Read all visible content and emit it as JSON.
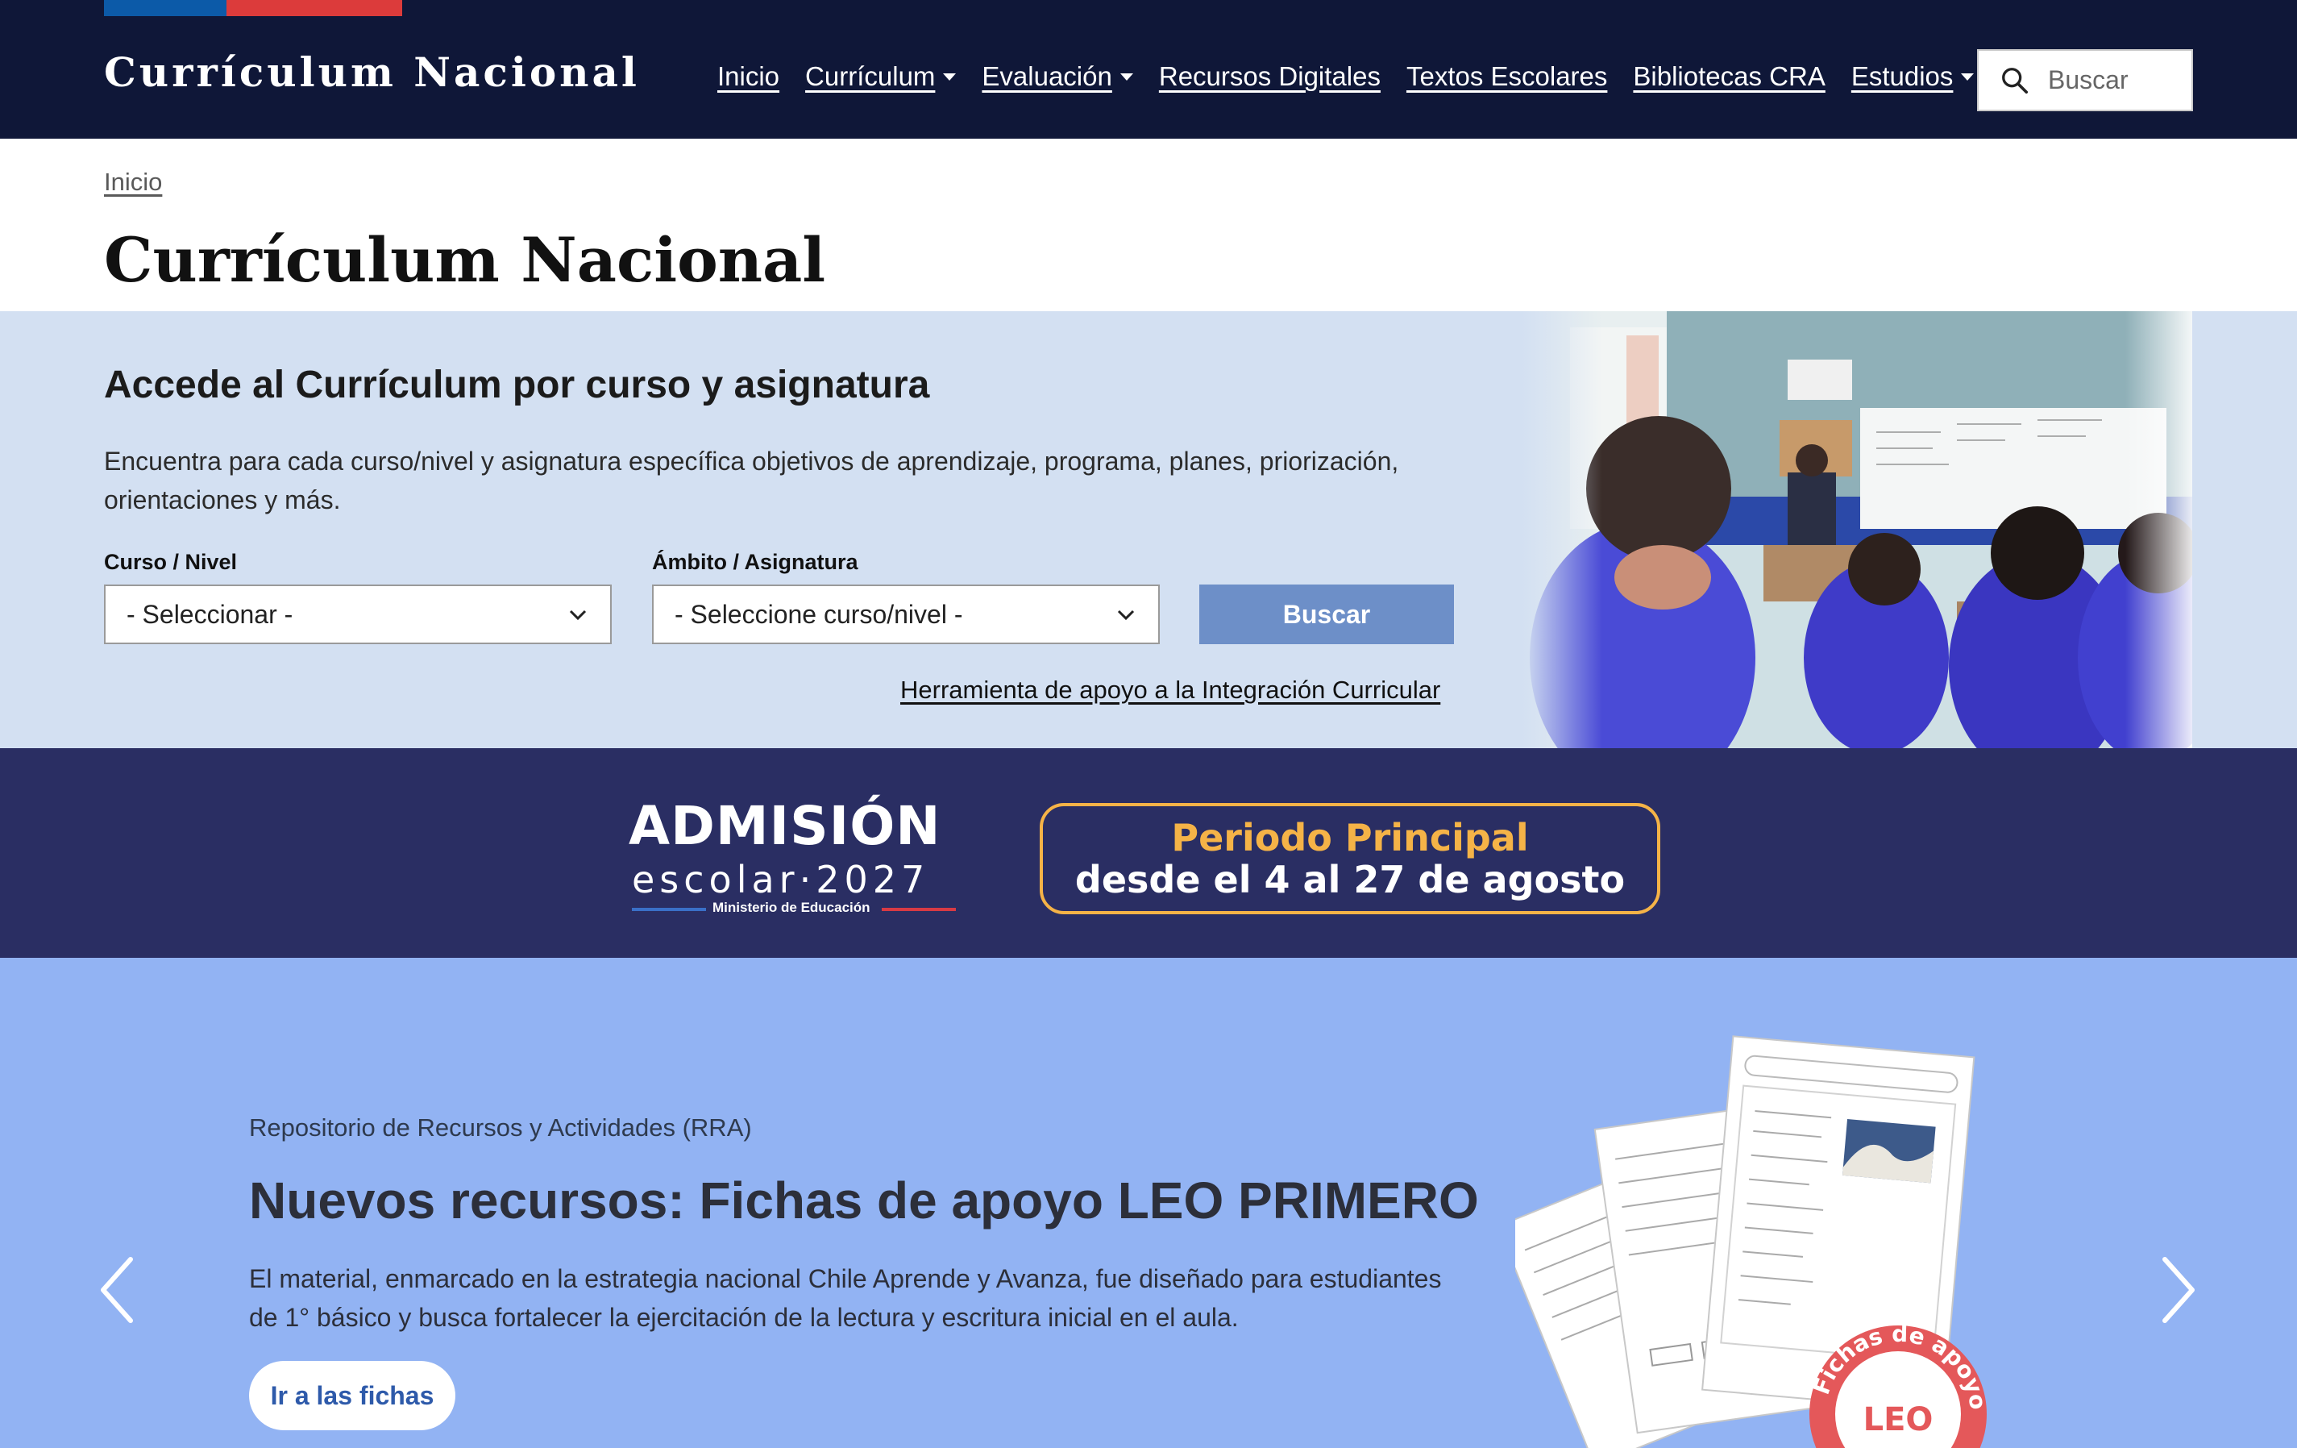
{
  "header": {
    "brand": "Currículum Nacional",
    "nav": [
      {
        "label": "Inicio",
        "dropdown": false
      },
      {
        "label": "Currículum",
        "dropdown": true
      },
      {
        "label": "Evaluación",
        "dropdown": true
      },
      {
        "label": "Recursos Digitales",
        "dropdown": false
      },
      {
        "label": "Textos Escolares",
        "dropdown": false
      },
      {
        "label": "Bibliotecas CRA",
        "dropdown": false
      },
      {
        "label": "Estudios",
        "dropdown": true
      }
    ],
    "search_placeholder": "Buscar"
  },
  "breadcrumb": "Inicio",
  "page_title": "Currículum Nacional",
  "curriculum": {
    "heading": "Accede al Currículum por curso y asignatura",
    "description": "Encuentra para cada curso/nivel y asignatura específica objetivos de aprendizaje, programa, planes, priorización, orientaciones y más.",
    "curso_label": "Curso / Nivel",
    "curso_value": "- Seleccionar -",
    "ambito_label": "Ámbito / Asignatura",
    "ambito_value": "- Seleccione curso/nivel -",
    "search_button": "Buscar",
    "tool_link": "Herramienta de apoyo a la Integración Curricular"
  },
  "admision": {
    "title": "ADMISIÓN",
    "subtitle": "escolar·2027",
    "ministry": "Ministerio de Educación",
    "period_title": "Periodo Principal",
    "period_dates": "desde el 4 al 27 de agosto"
  },
  "rra": {
    "kicker": "Repositorio de Recursos y Actividades (RRA)",
    "title": "Nuevos recursos: Fichas de apoyo LEO PRIMERO",
    "description": "El material, enmarcado en la estrategia nacional Chile Aprende y Avanza, fue diseñado para estudiantes de 1° básico y busca fortalecer la ejercitación de la lectura y escritura inicial en el aula.",
    "button": "Ir a las fichas",
    "badge_text": "Fichas de apoyo",
    "badge_logo": "LEO"
  },
  "colors": {
    "header_bg": "#0f1738",
    "search_section_bg": "#d3e0f2",
    "admision_bg": "#2a2e63",
    "admision_accent": "#f5b347",
    "rra_bg": "#92b3f3",
    "button_bg": "#6d8fc8"
  },
  "icons": {
    "search": "search-icon",
    "select_chevron": "chevron-down-icon",
    "carousel_prev": "chevron-left-icon",
    "carousel_next": "chevron-right-icon"
  }
}
